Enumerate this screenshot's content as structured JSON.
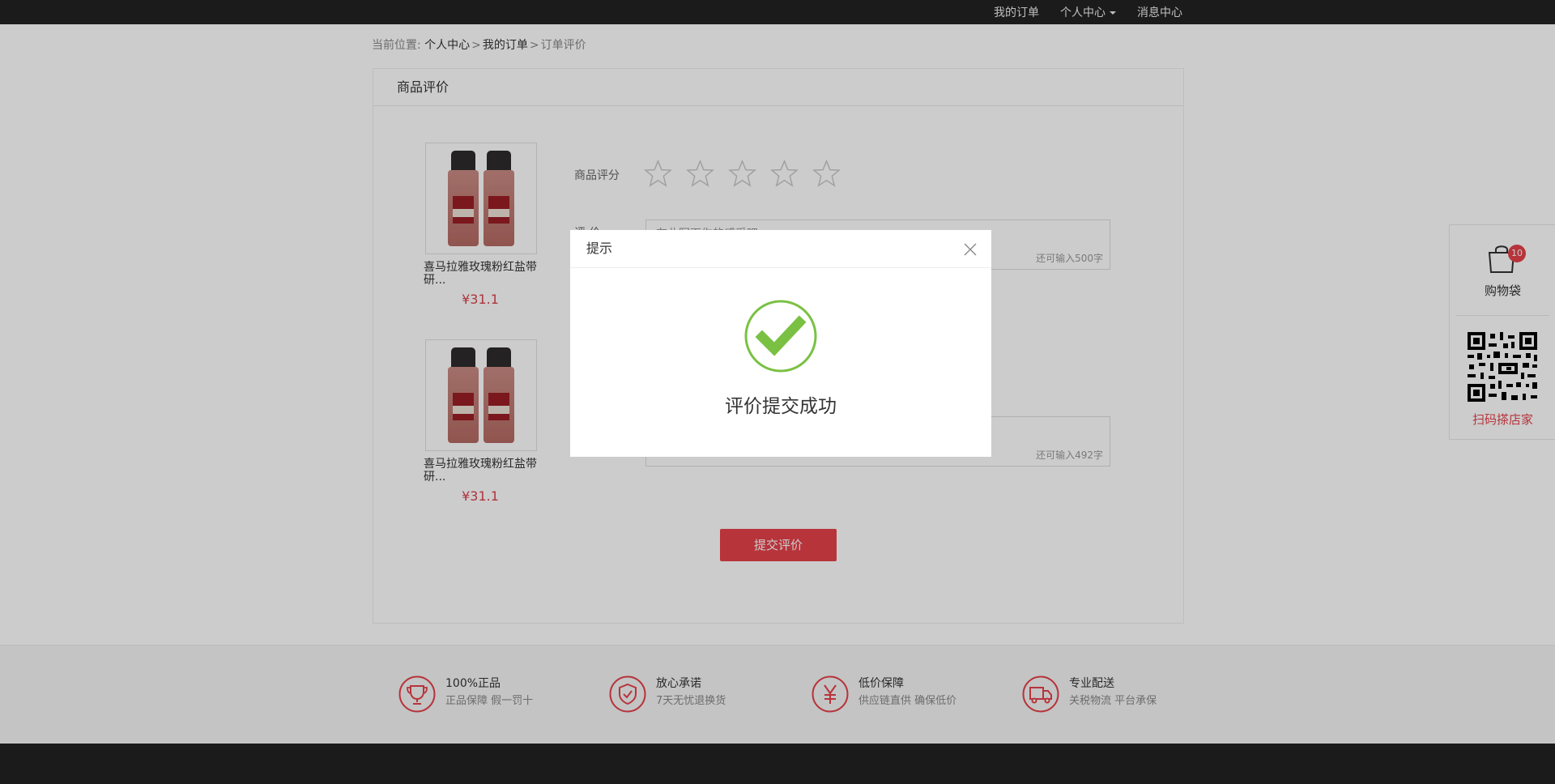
{
  "topnav": {
    "orders": "我的订单",
    "account": "个人中心",
    "messages": "消息中心"
  },
  "breadcrumb": {
    "prefix": "当前位置:",
    "items": [
      "个人中心",
      "我的订单",
      "订单评价"
    ],
    "separator": ">"
  },
  "panel": {
    "title": "商品评价",
    "rating_label": "商品评分",
    "review_label": "评 价",
    "review_placeholder": "在此写下你的感受吧",
    "products": [
      {
        "name": "喜马拉雅玫瑰粉红盐带研...",
        "price": "¥31.1",
        "remaining": "还可输入500字"
      },
      {
        "name": "喜马拉雅玫瑰粉红盐带研...",
        "price": "¥31.1",
        "remaining": "还可输入492字"
      }
    ],
    "submit_label": "提交评价"
  },
  "features": [
    {
      "title": "100%正品",
      "sub": "正品保障  假一罚十",
      "icon": "trophy-icon"
    },
    {
      "title": "放心承诺",
      "sub": "7天无忧退换货",
      "icon": "shield-check-icon"
    },
    {
      "title": "低价保障",
      "sub": "供应链直供  确保低价",
      "icon": "yen-icon"
    },
    {
      "title": "专业配送",
      "sub": "关税物流 平台承保",
      "icon": "truck-icon"
    }
  ],
  "sidebar": {
    "cart_label": "购物袋",
    "cart_count": "10",
    "qr_label": "扫码搽店家"
  },
  "modal": {
    "title": "提示",
    "message": "评价提交成功"
  },
  "colors": {
    "accent": "#e5414a",
    "success": "#7ac143",
    "topbar": "#222222"
  }
}
